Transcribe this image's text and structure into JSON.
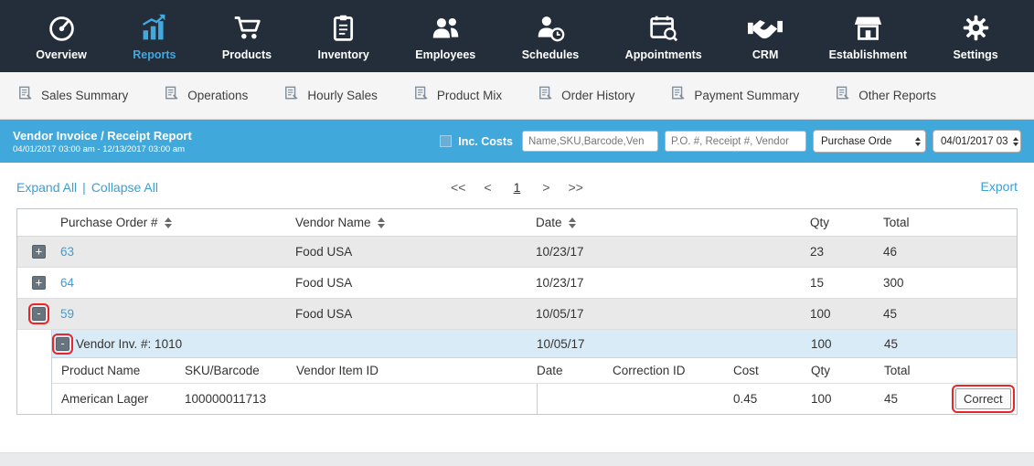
{
  "colors": {
    "nav_bg": "#232e3a",
    "accent_blue": "#41a8dc",
    "link_blue": "#3b9fd4",
    "active_nav_blue": "#3fa9e0",
    "annotation_red": "#e8262a",
    "row_gray": "#e9e9e9",
    "expanded_row_blue": "#d9ebf7"
  },
  "nav": {
    "items": [
      {
        "label": "Overview",
        "icon": "gauge-icon",
        "active": false
      },
      {
        "label": "Reports",
        "icon": "bar-chart-icon",
        "active": true
      },
      {
        "label": "Products",
        "icon": "shopping-cart-icon",
        "active": false
      },
      {
        "label": "Inventory",
        "icon": "clipboard-icon",
        "active": false
      },
      {
        "label": "Employees",
        "icon": "people-icon",
        "active": false
      },
      {
        "label": "Schedules",
        "icon": "person-clock-icon",
        "active": false
      },
      {
        "label": "Appointments",
        "icon": "calendar-search-icon",
        "active": false
      },
      {
        "label": "CRM",
        "icon": "handshake-icon",
        "active": false
      },
      {
        "label": "Establishment",
        "icon": "storefront-icon",
        "active": false
      },
      {
        "label": "Settings",
        "icon": "gear-icon",
        "active": false
      }
    ]
  },
  "subnav": {
    "items": [
      {
        "label": "Sales Summary"
      },
      {
        "label": "Operations"
      },
      {
        "label": "Hourly Sales"
      },
      {
        "label": "Product Mix"
      },
      {
        "label": "Order History"
      },
      {
        "label": "Payment Summary"
      },
      {
        "label": "Other Reports"
      }
    ]
  },
  "report_header": {
    "title": "Vendor Invoice / Receipt Report",
    "date_range": "04/01/2017 03:00 am - 12/13/2017 03:00 am",
    "inc_costs_label": "Inc. Costs",
    "search_name_placeholder": "Name,SKU,Barcode,Ven",
    "search_po_placeholder": "P.O. #, Receipt #, Vendor",
    "report_type_value": "Purchase Orde",
    "date_select_value": "04/01/2017 03"
  },
  "toolbar": {
    "expand_all": "Expand All",
    "separator": "|",
    "collapse_all": "Collapse All",
    "export_label": "Export",
    "pagination": {
      "first": "<<",
      "prev": "<",
      "page": "1",
      "next": ">",
      "last": ">>"
    }
  },
  "table": {
    "headers": [
      "Purchase Order #",
      "Vendor Name",
      "Date",
      "Qty",
      "Total"
    ],
    "expand_symbol": "+",
    "collapse_symbol": "-",
    "rows": [
      {
        "po": "63",
        "vendor": "Food USA",
        "date": "10/23/17",
        "qty": "23",
        "total": "46"
      },
      {
        "po": "64",
        "vendor": "Food USA",
        "date": "10/23/17",
        "qty": "15",
        "total": "300"
      },
      {
        "po": "59",
        "vendor": "Food USA",
        "date": "10/05/17",
        "qty": "100",
        "total": "45"
      }
    ],
    "expanded_detail": {
      "invoice_label": "Vendor Inv. #: 1010",
      "date": "10/05/17",
      "qty": "100",
      "total": "45",
      "sub_headers": [
        "Product Name",
        "SKU/Barcode",
        "Vendor Item ID",
        "Date",
        "Correction ID",
        "Cost",
        "Qty",
        "Total"
      ],
      "sub_rows": [
        {
          "product": "American Lager",
          "sku": "100000011713",
          "vendor_item_id": "",
          "date": "",
          "correction_id": "",
          "cost": "0.45",
          "qty": "100",
          "total": "45",
          "action_label": "Correct"
        }
      ]
    }
  }
}
